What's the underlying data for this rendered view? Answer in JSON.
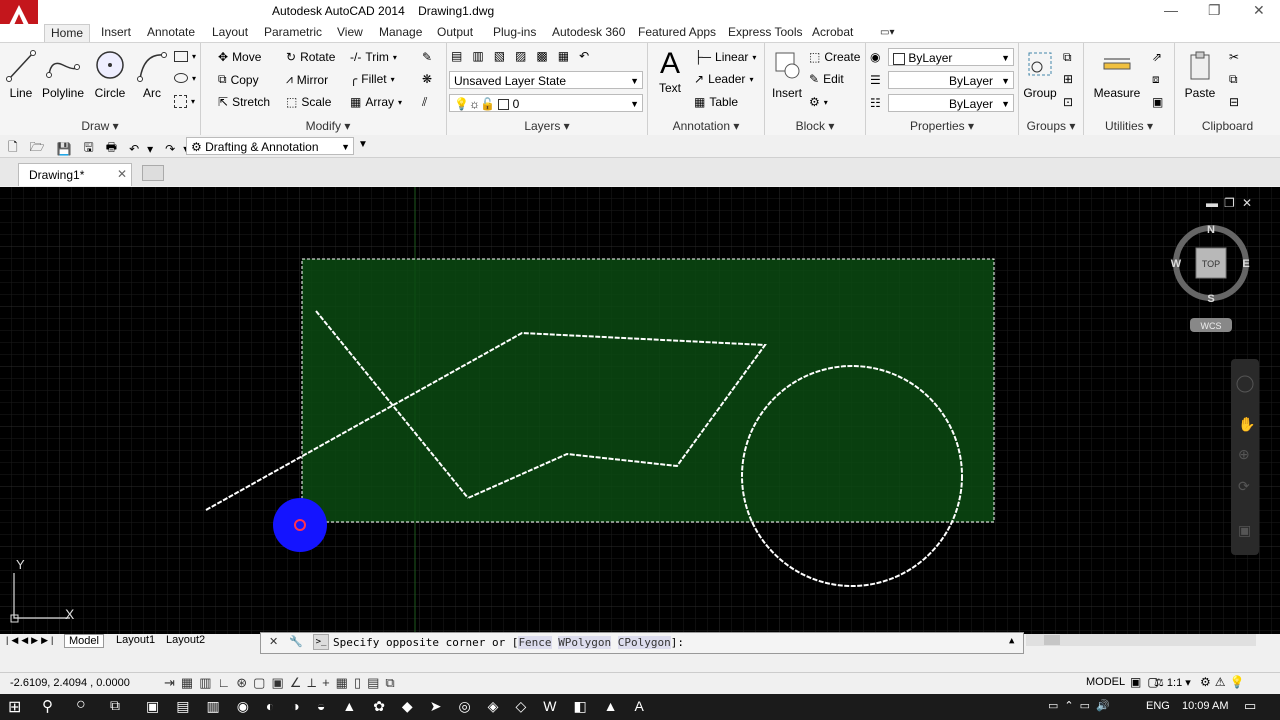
{
  "titlebar": {
    "app": "Autodesk AutoCAD 2014",
    "file": "Drawing1.dwg",
    "minimize": "—",
    "restore": "❐",
    "close": "✕"
  },
  "ribbon_tabs": [
    "Home",
    "Insert",
    "Annotate",
    "Layout",
    "Parametric",
    "View",
    "Manage",
    "Output",
    "Plug-ins",
    "Autodesk 360",
    "Featured Apps",
    "Express Tools",
    "Acrobat"
  ],
  "draw": {
    "title": "Draw ▾",
    "line": "Line",
    "polyline": "Polyline",
    "circle": "Circle",
    "arc": "Arc"
  },
  "modify": {
    "title": "Modify ▾",
    "move": "Move",
    "rotate": "Rotate",
    "trim": "Trim",
    "copy": "Copy",
    "mirror": "Mirror",
    "fillet": "Fillet",
    "stretch": "Stretch",
    "scale": "Scale",
    "array": "Array"
  },
  "layers": {
    "title": "Layers ▾",
    "state": "Unsaved Layer State",
    "current": "0"
  },
  "annotation": {
    "title": "Annotation ▾",
    "text": "Text",
    "linear": "Linear",
    "leader": "Leader",
    "table": "Table"
  },
  "block": {
    "title": "Block ▾",
    "insert": "Insert",
    "create": "Create",
    "edit": "Edit"
  },
  "properties": {
    "title": "Properties ▾",
    "color": "ByLayer",
    "linetype": "ByLayer",
    "lineweight": "ByLayer"
  },
  "groups": {
    "title": "Groups ▾",
    "group": "Group"
  },
  "utilities": {
    "title": "Utilities ▾",
    "measure": "Measure"
  },
  "clipboard": {
    "title": "Clipboard",
    "paste": "Paste"
  },
  "qat": {
    "workspace": "Drafting & Annotation"
  },
  "doc_tab": {
    "name": "Drawing1*",
    "close": "✕"
  },
  "viewcube": {
    "n": "N",
    "s": "S",
    "e": "E",
    "w": "W",
    "top": "TOP",
    "wcs": "WCS"
  },
  "ucs": {
    "x": "X",
    "y": "Y"
  },
  "layout_tabs": [
    "Model",
    "Layout1",
    "Layout2"
  ],
  "command": {
    "prompt": "Specify opposite corner or [",
    "opt1": "Fence",
    "opt2": "WPolygon",
    "opt3": "CPolygon",
    "end": "]:"
  },
  "status": {
    "coords": "-2.6109, 2.4094 , 0.0000",
    "model": "MODEL",
    "scale": "1:1"
  },
  "taskbar": {
    "lang": "ENG",
    "time": "10:09 AM"
  },
  "colors": {
    "selection_fill": "#0b4a12",
    "app_red": "#c4161c",
    "grip_blue": "#1414ff"
  }
}
